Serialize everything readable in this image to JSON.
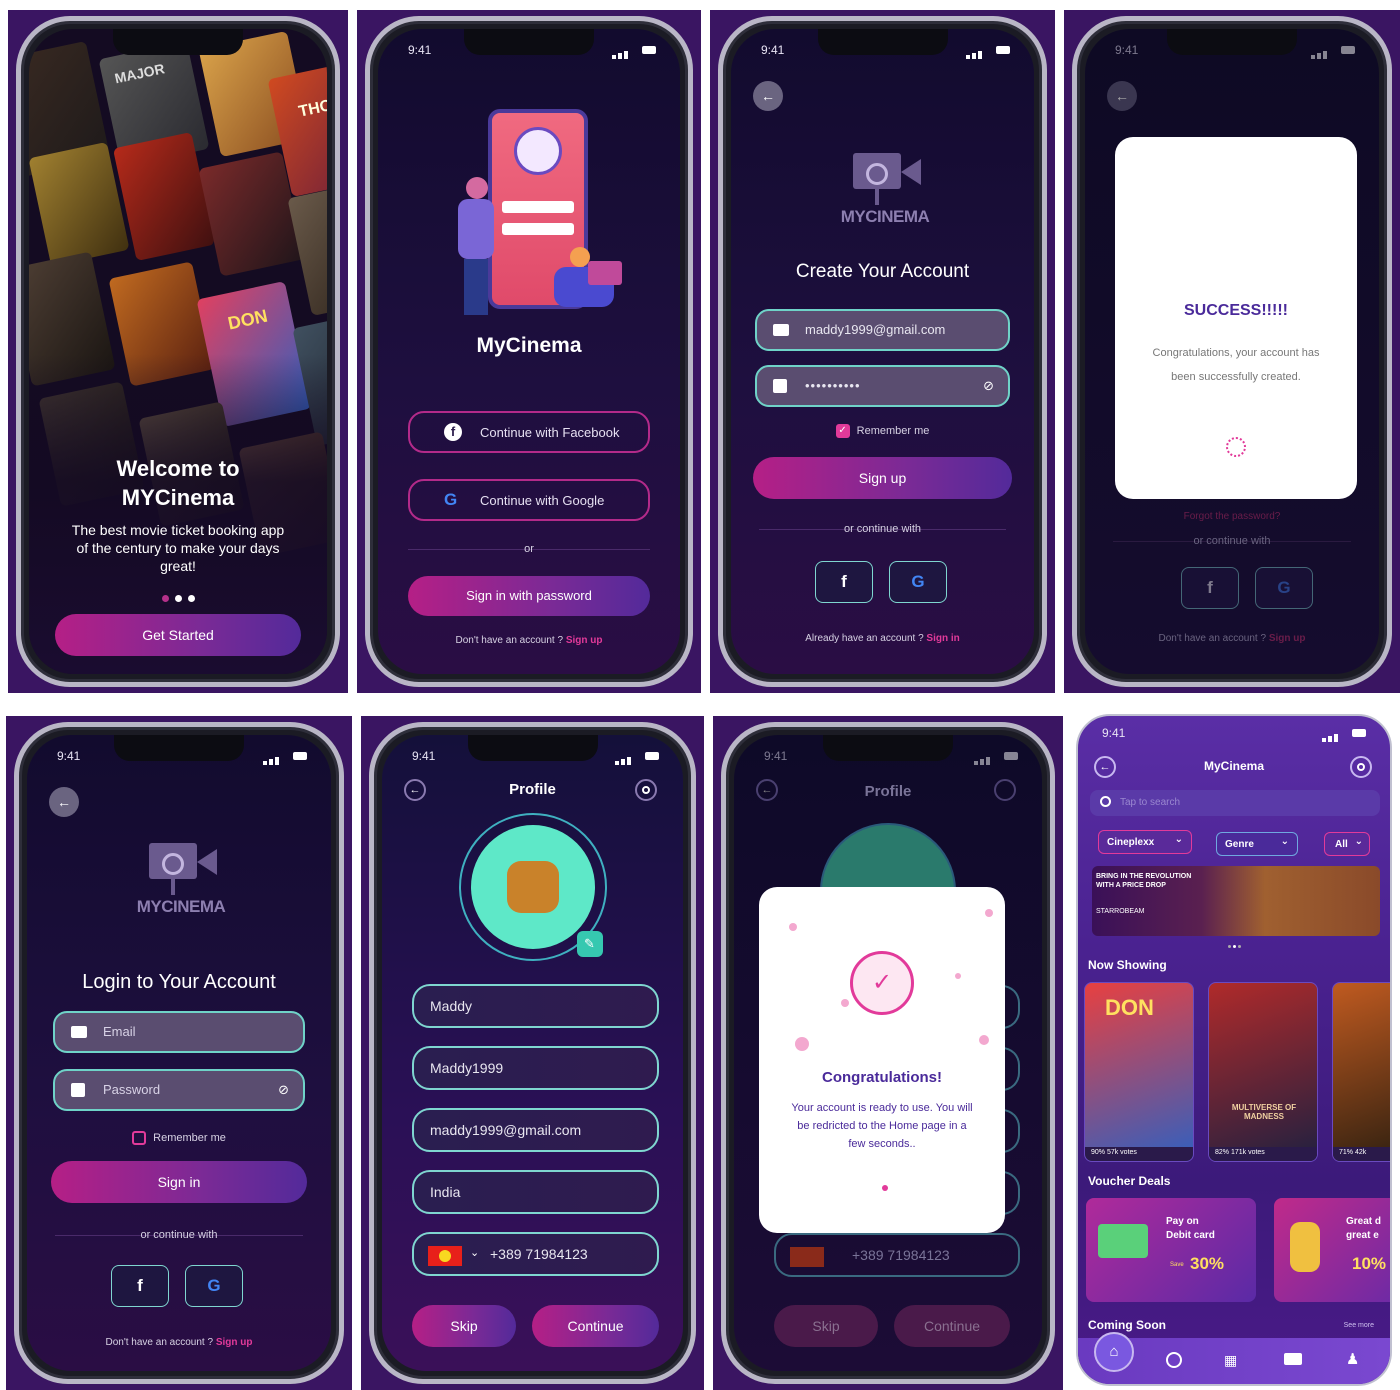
{
  "status": {
    "time": "9:41"
  },
  "welcome": {
    "title_line1": "Welcome to",
    "title_line2": "MYCinema",
    "subtitle": "The best movie ticket booking app of the century to make your days great!",
    "cta": "Get Started",
    "posters": [
      "MAJOR",
      "THOR",
      "DON"
    ]
  },
  "signin_options": {
    "app_name": "MyCinema",
    "facebook": "Continue with Facebook",
    "google": "Continue with Google",
    "or": "or",
    "password": "Sign in with password",
    "no_account": "Don't have an account ?",
    "signup": "Sign up"
  },
  "brand": {
    "logo_text": "MYCINEMA"
  },
  "create": {
    "title": "Create Your Account",
    "email": "maddy1999@gmail.com",
    "password": "••••••••••",
    "remember": "Remember me",
    "signup": "Sign up",
    "or_continue": "or continue with",
    "have_account": "Already have an account ?",
    "signin": "Sign in"
  },
  "success": {
    "title": "SUCCESS!!!!!",
    "message": "Congratulations, your account has been successfully created.",
    "forgot": "Forgot the password?",
    "or_continue": "or continue with",
    "no_account": "Don't have an account ?",
    "signup": "Sign up"
  },
  "login": {
    "title": "Login to Your Account",
    "email_placeholder": "Email",
    "password_placeholder": "Password",
    "remember": "Remember me",
    "signin": "Sign in",
    "or_continue": "or continue with",
    "no_account": "Don't have an account ?",
    "signup": "Sign up"
  },
  "profile": {
    "title": "Profile",
    "name": "Maddy",
    "username": "Maddy1999",
    "email": "maddy1999@gmail.com",
    "country": "India",
    "phone": "+389 71984123",
    "skip": "Skip",
    "continue": "Continue"
  },
  "congrats": {
    "title": "Congratulations!",
    "message": "Your account is ready to use. You will be redricted to the Home page in a few seconds.."
  },
  "home": {
    "app_name": "MyCinema",
    "search_placeholder": "Tap to search",
    "filters": [
      "Cineplexx",
      "Genre",
      "All"
    ],
    "now_showing": "Now Showing",
    "movies": [
      {
        "title": "DON",
        "rating": "90% 57k votes"
      },
      {
        "title": "MULTIVERSE OF MADNESS",
        "rating": "82% 171k votes"
      },
      {
        "title": "",
        "rating": "71% 42k"
      }
    ],
    "banner_text": "BRING IN THE REVOLUTION WITH A PRICE DROP",
    "banner_brand": "STARROBEAM",
    "voucher_deals": "Voucher Deals",
    "voucher1": {
      "line1": "Pay on",
      "line2": "Debit card",
      "save": "Save",
      "pct": "30%"
    },
    "voucher2": {
      "line1": "Great d",
      "line2": "great e",
      "pct": "10%"
    },
    "coming_soon": "Coming Soon",
    "see_more": "See more"
  },
  "colors": {
    "accent": "#e23a9a",
    "bg": "#1e0f3f",
    "teal": "#6fd3c8"
  }
}
